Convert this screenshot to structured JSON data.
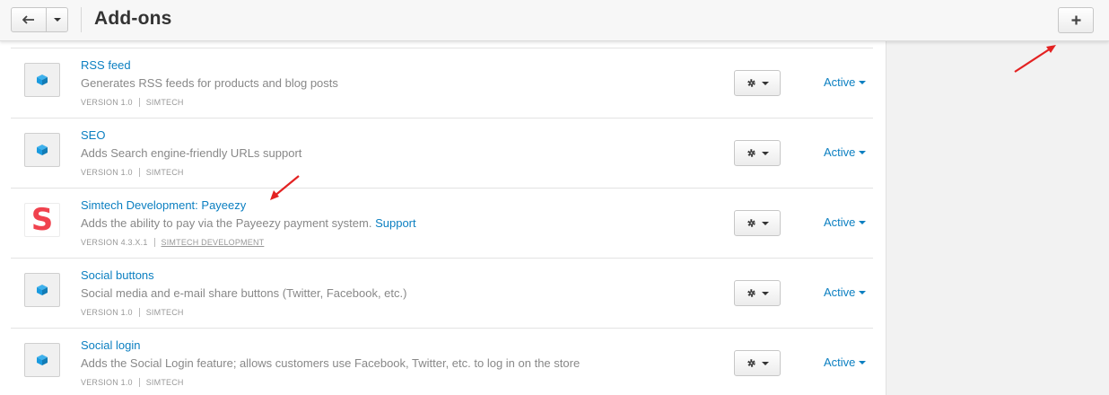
{
  "header": {
    "title": "Add-ons",
    "back_icon": "back-arrow-icon",
    "add_icon": "plus-icon"
  },
  "colors": {
    "link": "#0b7fc1",
    "annotation_arrow": "#e32222",
    "addon_cube": "#1a9be0",
    "payeezy_logo": "#f0424e"
  },
  "addons": [
    {
      "name": "RSS feed",
      "description": "Generates RSS feeds for products and blog posts",
      "version": "VERSION 1.0",
      "developer": "SIMTECH",
      "status": "Active",
      "icon": "cube-icon"
    },
    {
      "name": "SEO",
      "description": "Adds Search engine-friendly URLs support",
      "version": "VERSION 1.0",
      "developer": "SIMTECH",
      "status": "Active",
      "icon": "cube-icon"
    },
    {
      "name": "Simtech Development: Payeezy",
      "description": "Adds the ability to pay via the Payeezy payment system.",
      "support_link": "Support",
      "version": "VERSION 4.3.X.1",
      "developer": "SIMTECH DEVELOPMENT",
      "status": "Active",
      "icon": "simtech-logo-icon",
      "logo_letter": "S"
    },
    {
      "name": "Social buttons",
      "description": "Social media and e-mail share buttons (Twitter, Facebook, etc.)",
      "version": "VERSION 1.0",
      "developer": "SIMTECH",
      "status": "Active",
      "icon": "cube-icon"
    },
    {
      "name": "Social login",
      "description": "Adds the Social Login feature; allows customers use Facebook, Twitter, etc. to log in on the store",
      "version": "VERSION 1.0",
      "developer": "SIMTECH",
      "status": "Active",
      "icon": "cube-icon"
    }
  ]
}
